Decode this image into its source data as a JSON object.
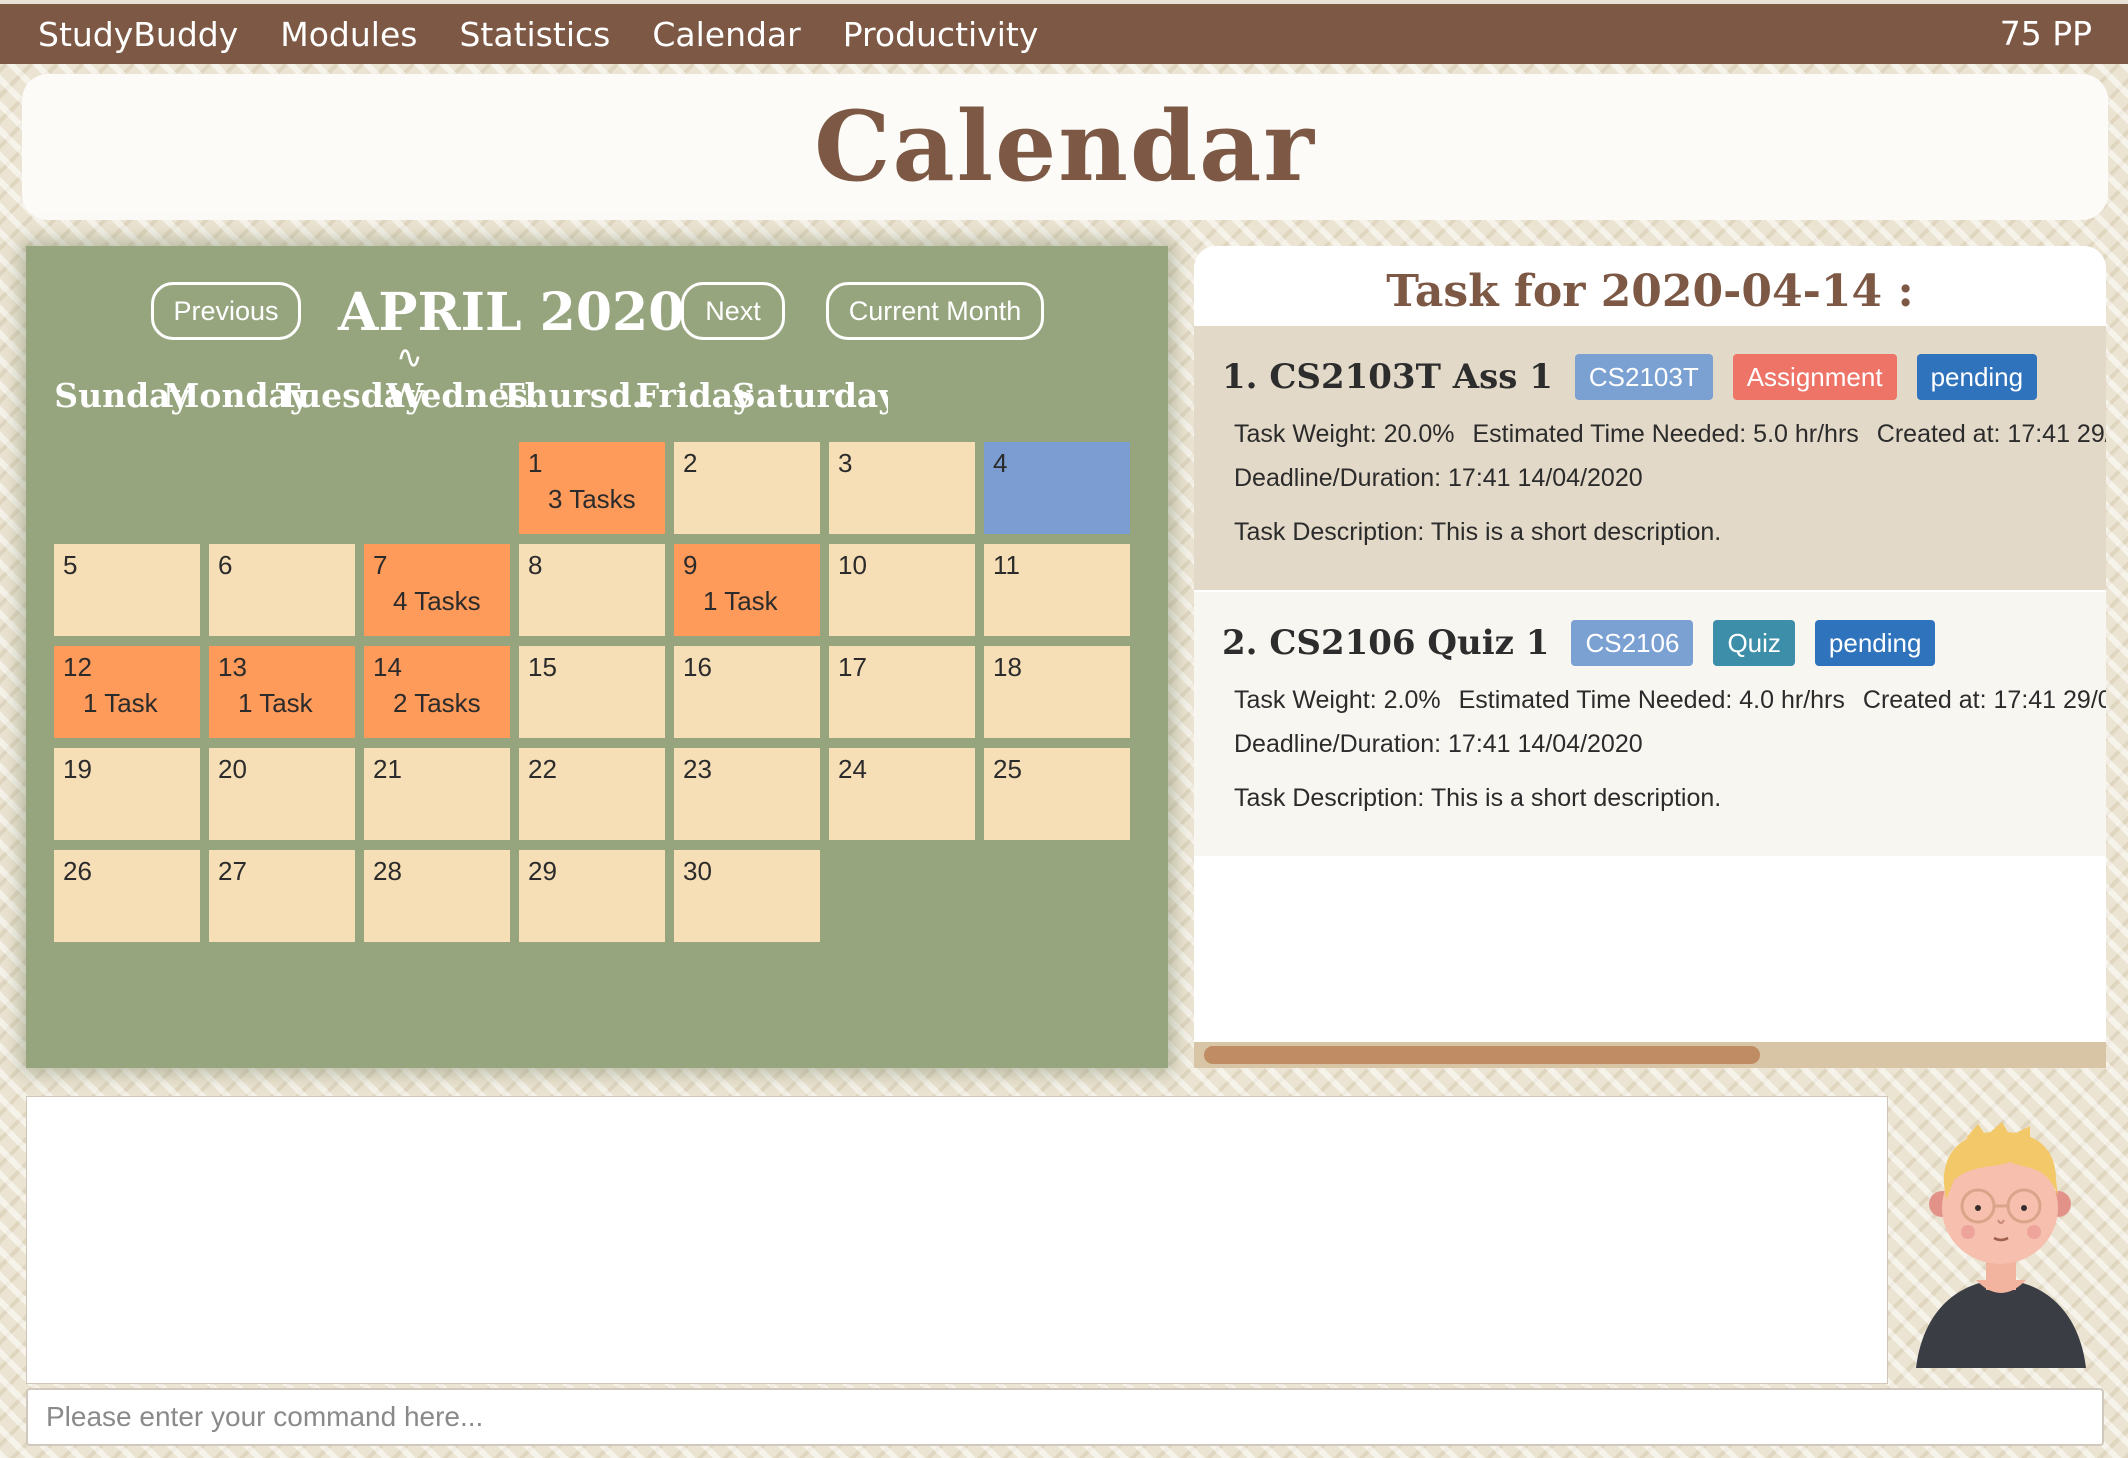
{
  "menu": {
    "items": [
      "StudyBuddy",
      "Modules",
      "Statistics",
      "Calendar",
      "Productivity"
    ],
    "points": "75 PP"
  },
  "page_title": "Calendar",
  "calendar": {
    "previous_label": "Previous",
    "next_label": "Next",
    "current_month_label": "Current Month",
    "month_label": "APRIL  2020",
    "weekdays": [
      "Sunday",
      "Monday",
      "Tuesday",
      "Wednes...",
      "Thursd...",
      "Friday",
      "Saturday"
    ],
    "days": [
      {
        "num": "1",
        "tasks": "3 Tasks"
      },
      {
        "num": "2",
        "tasks": ""
      },
      {
        "num": "3",
        "tasks": ""
      },
      {
        "num": "4",
        "tasks": ""
      },
      {
        "num": "5",
        "tasks": ""
      },
      {
        "num": "6",
        "tasks": ""
      },
      {
        "num": "7",
        "tasks": "4 Tasks"
      },
      {
        "num": "8",
        "tasks": ""
      },
      {
        "num": "9",
        "tasks": "1 Task"
      },
      {
        "num": "10",
        "tasks": ""
      },
      {
        "num": "11",
        "tasks": ""
      },
      {
        "num": "12",
        "tasks": "1 Task"
      },
      {
        "num": "13",
        "tasks": "1 Task"
      },
      {
        "num": "14",
        "tasks": "2 Tasks"
      },
      {
        "num": "15",
        "tasks": ""
      },
      {
        "num": "16",
        "tasks": ""
      },
      {
        "num": "17",
        "tasks": ""
      },
      {
        "num": "18",
        "tasks": ""
      },
      {
        "num": "19",
        "tasks": ""
      },
      {
        "num": "20",
        "tasks": ""
      },
      {
        "num": "21",
        "tasks": ""
      },
      {
        "num": "22",
        "tasks": ""
      },
      {
        "num": "23",
        "tasks": ""
      },
      {
        "num": "24",
        "tasks": ""
      },
      {
        "num": "25",
        "tasks": ""
      },
      {
        "num": "26",
        "tasks": ""
      },
      {
        "num": "27",
        "tasks": ""
      },
      {
        "num": "28",
        "tasks": ""
      },
      {
        "num": "29",
        "tasks": ""
      },
      {
        "num": "30",
        "tasks": ""
      }
    ],
    "highlighted_day": "4"
  },
  "tasks_panel": {
    "title": "Task for 2020-04-14 :",
    "tasks": [
      {
        "name": "1.  CS2103T Ass 1",
        "tags": [
          {
            "label": "CS2103T",
            "color": "#7ba0d2"
          },
          {
            "label": "Assignment",
            "color": "#ed7467"
          },
          {
            "label": "pending",
            "color": "#2f73bd"
          }
        ],
        "weight": "Task Weight: 20.0%",
        "time_needed": "Estimated Time Needed: 5.0 hr/hrs",
        "created": "Created at: 17:41 29/",
        "deadline": "Deadline/Duration: 17:41 14/04/2020",
        "description": "Task Description: This is a short description."
      },
      {
        "name": "2.  CS2106 Quiz 1",
        "tags": [
          {
            "label": "CS2106",
            "color": "#7ba0d2"
          },
          {
            "label": "Quiz",
            "color": "#3d8ea8"
          },
          {
            "label": "pending",
            "color": "#2f73bd"
          }
        ],
        "weight": "Task Weight: 2.0%",
        "time_needed": "Estimated Time Needed: 4.0 hr/hrs",
        "created": "Created at: 17:41 29/0",
        "deadline": "Deadline/Duration: 17:41 14/04/2020",
        "description": "Task Description: This is a short description."
      }
    ]
  },
  "command": {
    "placeholder": "Please enter your command here..."
  },
  "colors": {
    "menu_bg": "#7c5845",
    "calendar_bg": "#96a57e",
    "day_cell": "#f6deb6",
    "task_day": "#fe9a5a",
    "today_day": "#7c9dd1"
  }
}
